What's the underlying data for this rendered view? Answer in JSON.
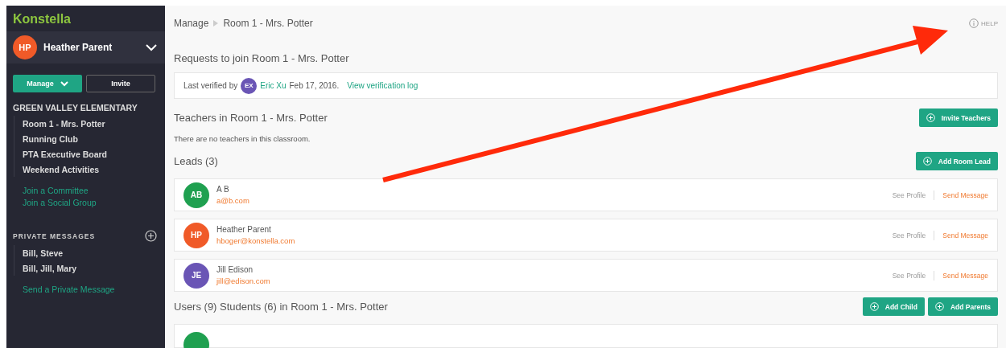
{
  "sidebar": {
    "brand": "Konstella",
    "user": {
      "initials": "HP",
      "name": "Heather Parent",
      "color": "#f05a28"
    },
    "buttons": [
      {
        "label": "Manage",
        "kind": "primary"
      },
      {
        "label": "Invite",
        "kind": "outline"
      }
    ],
    "school": "GREEN VALLEY ELEMENTARY",
    "groups": [
      {
        "label": "Room 1 - Mrs. Potter"
      },
      {
        "label": "Running Club"
      },
      {
        "label": "PTA Executive Board"
      },
      {
        "label": "Weekend Activities"
      }
    ],
    "group_links": [
      "Join a Committee",
      "Join a Social Group"
    ],
    "messages_title": "PRIVATE MESSAGES",
    "messages": [
      {
        "label": "Bill, Steve"
      },
      {
        "label": "Bill, Jill, Mary"
      }
    ],
    "message_link": "Send a Private Message"
  },
  "breadcrumb": [
    "Manage",
    "Room 1 - Mrs. Potter"
  ],
  "help": "HELP",
  "requests": {
    "title": "Requests to join Room 1 - Mrs. Potter",
    "prefix": "Last verified by",
    "initials": "EX",
    "name": "Eric Xu",
    "date": "Feb 17, 2016.",
    "link": "View verification log"
  },
  "teachers": {
    "title": "Teachers in Room 1 - Mrs. Potter",
    "button": "Invite Teachers",
    "empty": "There are no teachers in this classroom."
  },
  "leads": {
    "title": "Leads (3)",
    "button": "Add Room Lead",
    "items": [
      {
        "initials": "AB",
        "name": "A B",
        "email": "a@b.com",
        "color": "#1fa050",
        "profile": "See Profile",
        "message": "Send Message"
      },
      {
        "initials": "HP",
        "name": "Heather Parent",
        "email": "hboger@konstella.com",
        "color": "#f05a28",
        "profile": "See Profile",
        "message": "Send Message"
      },
      {
        "initials": "JE",
        "name": "Jill Edison",
        "email": "jill@edison.com",
        "color": "#6a55b5",
        "profile": "See Profile",
        "message": "Send Message"
      }
    ]
  },
  "users": {
    "title": "Users (9) Students (6) in Room 1 - Mrs. Potter",
    "buttons": [
      "Add Child",
      "Add Parents"
    ]
  }
}
